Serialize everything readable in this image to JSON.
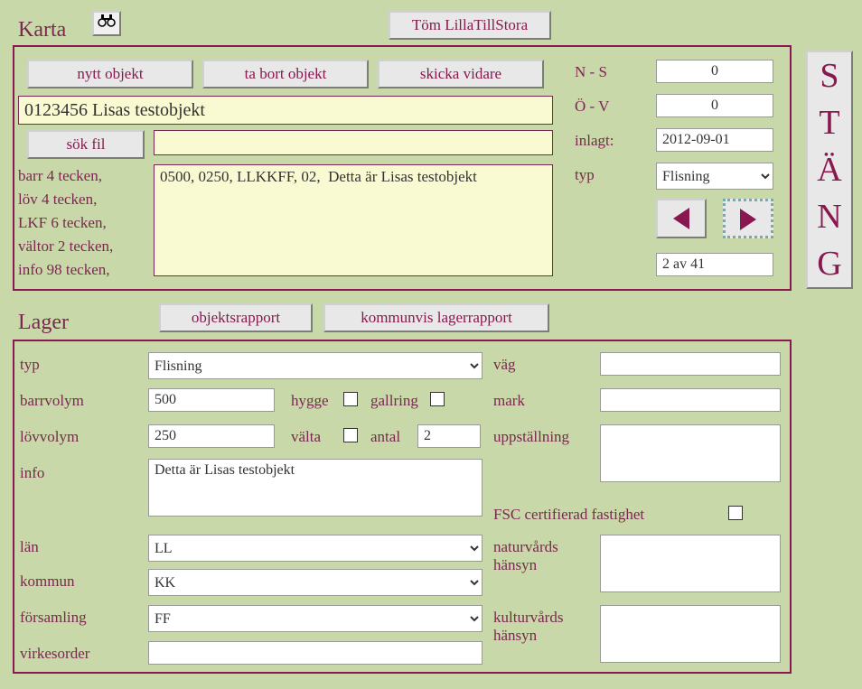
{
  "header": {
    "karta_title": "Karta",
    "binoculars_icon": "binoculars",
    "tom_button": "Töm LillaTillStora",
    "stang_button": "STÄNG"
  },
  "karta": {
    "nytt_label": "nytt objekt",
    "tabort_label": "ta bort objekt",
    "skicka_label": "skicka vidare",
    "ns_label": "N - S",
    "ns_value": "0",
    "ov_label": "Ö - V",
    "ov_value": "0",
    "inlagt_label": "inlagt:",
    "inlagt_value": "2012-09-01",
    "typ_label": "typ",
    "typ_value": "Flisning",
    "object_title": "0123456 Lisas testobjekt",
    "sok_label": "sök fil",
    "sok_value": "",
    "hint_lines": "barr 4 tecken,\nlöv 4 tecken,\nLKF 6 tecken,\nvältor 2 tecken,\ninfo 98 tecken,",
    "big_text": "0500, 0250, LLKKFF, 02,  Detta är Lisas testobjekt",
    "page_status": "2 av 41"
  },
  "lager_header": {
    "lager_title": "Lager",
    "objrapp_label": "objektsrapport",
    "kommrapp_label": "kommunvis lagerrapport"
  },
  "lager": {
    "typ_label": "typ",
    "typ_value": "Flisning",
    "barr_label": "barrvolym",
    "barr_value": "500",
    "hygge_label": "hygge",
    "hygge_checked": false,
    "gallr_label": "gallring",
    "gallr_checked": false,
    "lov_label": "lövvolym",
    "lov_value": "250",
    "valta_label": "välta",
    "valta_checked": false,
    "antal_label": "antal",
    "antal_value": "2",
    "info_label": "info",
    "info_value": "Detta är Lisas testobjekt",
    "lan_label": "län",
    "lan_value": "LL",
    "kom_label": "kommun",
    "kom_value": "KK",
    "for_label": "församling",
    "for_value": "FF",
    "vir_label": "virkesorder",
    "vir_value": "",
    "vag_label": "väg",
    "vag_value": "",
    "mark_label": "mark",
    "mark_value": "",
    "upp_label": "uppställning",
    "upp_value": "",
    "fsc_label": "FSC certifierad fastighet",
    "fsc_checked": false,
    "nat_label": "naturvårds hänsyn",
    "nat_value": "",
    "kul_label": "kulturvårds hänsyn",
    "kul_value": ""
  }
}
